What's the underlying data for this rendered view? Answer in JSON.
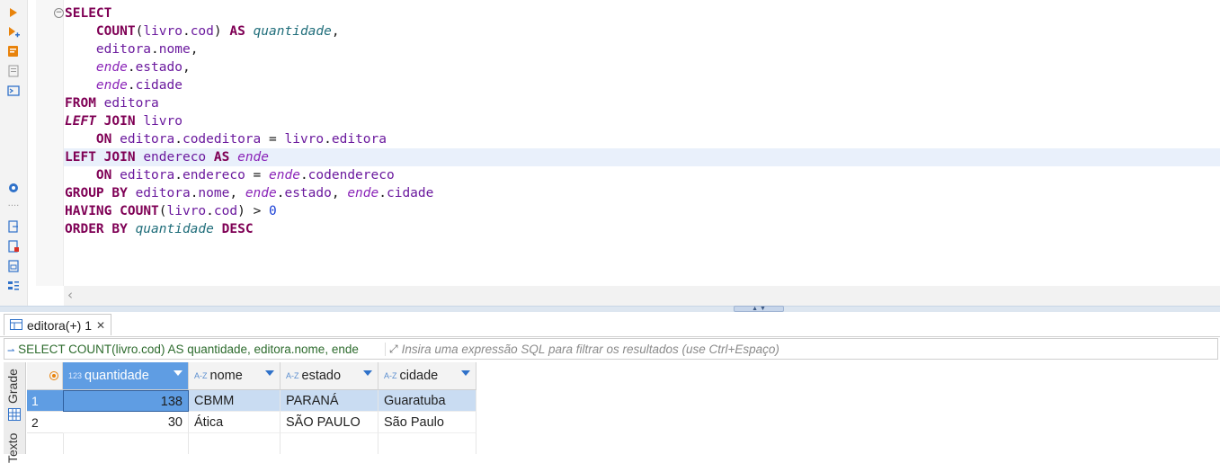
{
  "toolbar": {
    "icons": [
      "execute-icon",
      "execute-script-icon",
      "explain-plan-icon",
      "load-plan-icon",
      "console-icon",
      "settings-icon",
      "more-icon",
      "export-icon",
      "import-icon",
      "script-icon",
      "format-icon"
    ]
  },
  "editor": {
    "lines": [
      {
        "indent": "",
        "tokens": [
          {
            "t": "SELECT",
            "c": "kw"
          }
        ]
      },
      {
        "indent": "    ",
        "tokens": [
          {
            "t": "COUNT",
            "c": "kw"
          },
          {
            "t": "(",
            "c": ""
          },
          {
            "t": "livro",
            "c": "id"
          },
          {
            "t": ".",
            "c": ""
          },
          {
            "t": "cod",
            "c": "id"
          },
          {
            "t": ") ",
            "c": ""
          },
          {
            "t": "AS",
            "c": "kw"
          },
          {
            "t": " ",
            "c": ""
          },
          {
            "t": "quantidade",
            "c": "al"
          },
          {
            "t": ",",
            "c": ""
          }
        ]
      },
      {
        "indent": "    ",
        "tokens": [
          {
            "t": "editora",
            "c": "id"
          },
          {
            "t": ".",
            "c": ""
          },
          {
            "t": "nome",
            "c": "id"
          },
          {
            "t": ",",
            "c": ""
          }
        ]
      },
      {
        "indent": "    ",
        "tokens": [
          {
            "t": "ende",
            "c": "idi"
          },
          {
            "t": ".",
            "c": ""
          },
          {
            "t": "estado",
            "c": "id"
          },
          {
            "t": ",",
            "c": ""
          }
        ]
      },
      {
        "indent": "    ",
        "tokens": [
          {
            "t": "ende",
            "c": "idi"
          },
          {
            "t": ".",
            "c": ""
          },
          {
            "t": "cidade",
            "c": "id"
          }
        ]
      },
      {
        "indent": "",
        "tokens": [
          {
            "t": "FROM",
            "c": "kw"
          },
          {
            "t": " ",
            "c": ""
          },
          {
            "t": "editora",
            "c": "id"
          }
        ]
      },
      {
        "indent": "",
        "tokens": [
          {
            "t": "LEFT",
            "c": "kwi"
          },
          {
            "t": " ",
            "c": ""
          },
          {
            "t": "JOIN",
            "c": "kw"
          },
          {
            "t": " ",
            "c": ""
          },
          {
            "t": "livro",
            "c": "id"
          }
        ]
      },
      {
        "indent": "    ",
        "tokens": [
          {
            "t": "ON",
            "c": "kw"
          },
          {
            "t": " ",
            "c": ""
          },
          {
            "t": "editora",
            "c": "id"
          },
          {
            "t": ".",
            "c": ""
          },
          {
            "t": "codeditora",
            "c": "id"
          },
          {
            "t": " = ",
            "c": ""
          },
          {
            "t": "livro",
            "c": "id"
          },
          {
            "t": ".",
            "c": ""
          },
          {
            "t": "editora",
            "c": "id"
          }
        ]
      },
      {
        "indent": "",
        "highlight": true,
        "tokens": [
          {
            "t": "LEFT",
            "c": "kw"
          },
          {
            "t": " ",
            "c": ""
          },
          {
            "t": "JOIN",
            "c": "kw"
          },
          {
            "t": " ",
            "c": ""
          },
          {
            "t": "endereco",
            "c": "id"
          },
          {
            "t": " ",
            "c": ""
          },
          {
            "t": "AS",
            "c": "kw"
          },
          {
            "t": " ",
            "c": ""
          },
          {
            "t": "ende",
            "c": "idi"
          }
        ]
      },
      {
        "indent": "    ",
        "tokens": [
          {
            "t": "ON",
            "c": "kw"
          },
          {
            "t": " ",
            "c": ""
          },
          {
            "t": "editora",
            "c": "id"
          },
          {
            "t": ".",
            "c": ""
          },
          {
            "t": "endereco",
            "c": "id"
          },
          {
            "t": " = ",
            "c": ""
          },
          {
            "t": "ende",
            "c": "idi"
          },
          {
            "t": ".",
            "c": ""
          },
          {
            "t": "codendereco",
            "c": "id"
          }
        ]
      },
      {
        "indent": "",
        "tokens": [
          {
            "t": "GROUP BY",
            "c": "kw"
          },
          {
            "t": " ",
            "c": ""
          },
          {
            "t": "editora",
            "c": "id"
          },
          {
            "t": ".",
            "c": ""
          },
          {
            "t": "nome",
            "c": "id"
          },
          {
            "t": ", ",
            "c": ""
          },
          {
            "t": "ende",
            "c": "idi"
          },
          {
            "t": ".",
            "c": ""
          },
          {
            "t": "estado",
            "c": "id"
          },
          {
            "t": ", ",
            "c": ""
          },
          {
            "t": "ende",
            "c": "idi"
          },
          {
            "t": ".",
            "c": ""
          },
          {
            "t": "cidade",
            "c": "id"
          }
        ]
      },
      {
        "indent": "",
        "tokens": [
          {
            "t": "HAVING",
            "c": "kw"
          },
          {
            "t": " ",
            "c": ""
          },
          {
            "t": "COUNT",
            "c": "kw"
          },
          {
            "t": "(",
            "c": ""
          },
          {
            "t": "livro",
            "c": "id"
          },
          {
            "t": ".",
            "c": ""
          },
          {
            "t": "cod",
            "c": "id"
          },
          {
            "t": ") > ",
            "c": ""
          },
          {
            "t": "0",
            "c": "num"
          }
        ]
      },
      {
        "indent": "",
        "tokens": [
          {
            "t": "ORDER BY",
            "c": "kw"
          },
          {
            "t": " ",
            "c": ""
          },
          {
            "t": "quantidade",
            "c": "al"
          },
          {
            "t": " ",
            "c": ""
          },
          {
            "t": "DESC",
            "c": "kw"
          }
        ]
      }
    ]
  },
  "results": {
    "tab_label": "editora(+) 1",
    "filter_query_text": "SELECT COUNT(livro.cod) AS quantidade, editora.nome, ende",
    "filter_placeholder": "Insira uma expressão SQL para filtrar os resultados (use Ctrl+Espaço)",
    "side_tabs": [
      "Grade",
      "Texto"
    ],
    "columns": [
      {
        "name": "quantidade",
        "type": "123"
      },
      {
        "name": "nome",
        "type": "A-Z"
      },
      {
        "name": "estado",
        "type": "A-Z"
      },
      {
        "name": "cidade",
        "type": "A-Z"
      }
    ],
    "rows": [
      {
        "num": "1",
        "quantidade": "138",
        "nome": "CBMM",
        "estado": "PARANÁ",
        "cidade": "Guaratuba",
        "selected": true
      },
      {
        "num": "2",
        "quantidade": "30",
        "nome": "Ática",
        "estado": "SÃO PAULO",
        "cidade": "São Paulo",
        "selected": false
      }
    ]
  },
  "colors": {
    "keyword": "#7f0055",
    "identifier": "#6b1a9e",
    "alias": "#1f6d7a",
    "number": "#1a3fd6",
    "selected_row": "#c9dcf2",
    "selected_cell": "#5f9de3",
    "highlight_line": "#e9f0fb"
  }
}
